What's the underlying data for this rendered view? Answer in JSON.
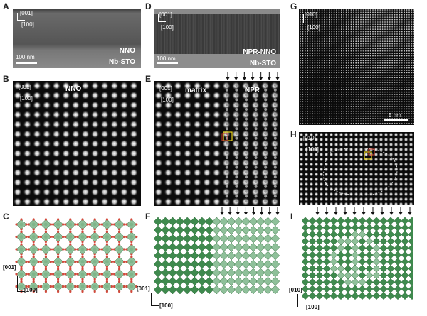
{
  "panels": {
    "A": {
      "label": "A",
      "dir1": "[001]",
      "dir2": "[100]",
      "scale": "100 nm",
      "top": "NNO",
      "bottom": "Nb-STO"
    },
    "B": {
      "label": "B",
      "dir1": "[001]",
      "dir2": "[100]",
      "name": "NNO"
    },
    "C": {
      "label": "C",
      "dir1": "[001]",
      "dir2": "[100]"
    },
    "D": {
      "label": "D",
      "dir1": "[001]",
      "dir2": "[100]",
      "scale": "100 nm",
      "top": "NPR-NNO",
      "bottom": "Nb-STO"
    },
    "E": {
      "label": "E",
      "dir1": "[001]",
      "dir2": "[100]",
      "left": "matrix",
      "right": "NPR"
    },
    "F": {
      "label": "F",
      "dir1": "[001]",
      "dir2": "[100]"
    },
    "G": {
      "label": "G",
      "dir1": "[010]",
      "dir2": "[100]",
      "scale": "5 nm"
    },
    "H": {
      "label": "H",
      "dir1": "[010]",
      "dir2": "[100]"
    },
    "I": {
      "label": "I",
      "dir1": "[010]",
      "dir2": "[100]"
    }
  },
  "colors": {
    "octahedron_light": "#8fc09a",
    "octahedron_dark": "#3f8a4e",
    "oxygen": "#d24a3c",
    "cation": "#7fb58a"
  }
}
